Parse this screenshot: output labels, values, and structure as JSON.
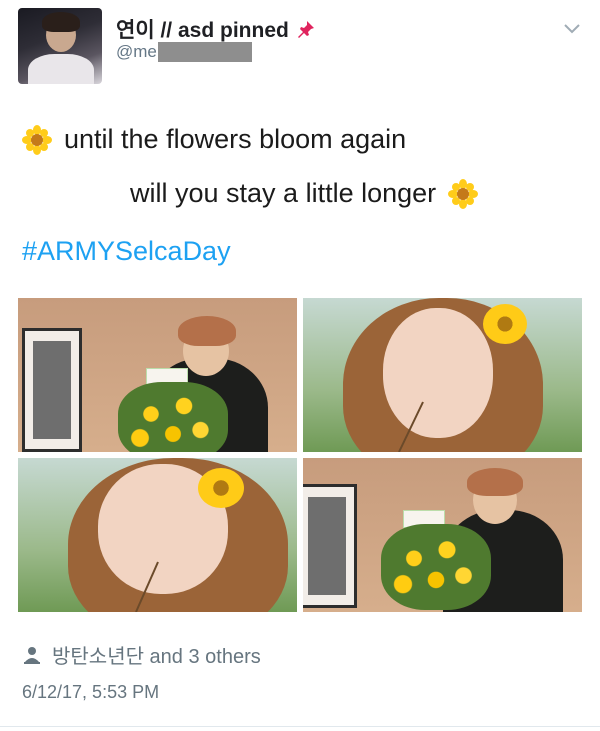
{
  "header": {
    "name": "연이 // asd pinned",
    "handle": "@me",
    "pin_icon": "pushpin-icon",
    "menu_icon": "chevron-down-icon"
  },
  "tweet": {
    "line1": "until the flowers bloom again",
    "line2": "will you stay a little longer",
    "hashtag": "#ARMYSelcaDay",
    "emoji_icon": "sunflower-icon"
  },
  "photos": [
    {
      "name": "photo-1"
    },
    {
      "name": "photo-2"
    },
    {
      "name": "photo-3"
    },
    {
      "name": "photo-4"
    }
  ],
  "footer": {
    "likes_text": "방탄소년단 and 3 others",
    "timestamp": "6/12/17, 5:53 PM",
    "person_icon": "person-icon"
  },
  "colors": {
    "link": "#1da1f2",
    "meta": "#66757f",
    "pin": "#e0245e"
  }
}
